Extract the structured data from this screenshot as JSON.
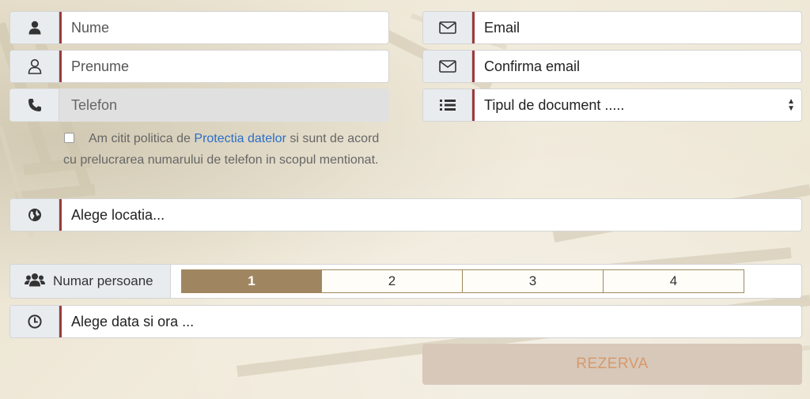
{
  "fields": {
    "nume": {
      "placeholder": "Nume"
    },
    "prenume": {
      "placeholder": "Prenume"
    },
    "telefon": {
      "placeholder": "Telefon"
    },
    "email": {
      "placeholder": "Email"
    },
    "confirma_email": {
      "placeholder": "Confirma email"
    },
    "tip_document": {
      "selected": "Tipul de document ....."
    },
    "locatie": {
      "selected": "Alege locatia..."
    },
    "data_ora": {
      "placeholder": "Alege data si ora ..."
    }
  },
  "consent": {
    "text_before": "Am citit politica de ",
    "link": "Protectia datelor",
    "text_after": " si sunt de acord cu prelucrarea numarului de telefon in scopul mentionat."
  },
  "persons": {
    "label": "Numar persoane",
    "options": [
      "1",
      "2",
      "3",
      "4"
    ],
    "selected": "1"
  },
  "submit_label": "REZERVA",
  "icons": {
    "nume": "user-solid-icon",
    "prenume": "user-outline-icon",
    "telefon": "phone-icon",
    "email": "envelope-icon",
    "confirma_email": "envelope-icon",
    "tip_document": "list-icon",
    "locatie": "globe-icon",
    "persons": "users-icon",
    "data_ora": "clock-icon"
  },
  "colors": {
    "accent_border": "#9c3b3b",
    "selected_option": "#a08660",
    "link": "#2a6fc9",
    "submit_bg": "#d7c8ba",
    "submit_text": "#d69a6b"
  }
}
